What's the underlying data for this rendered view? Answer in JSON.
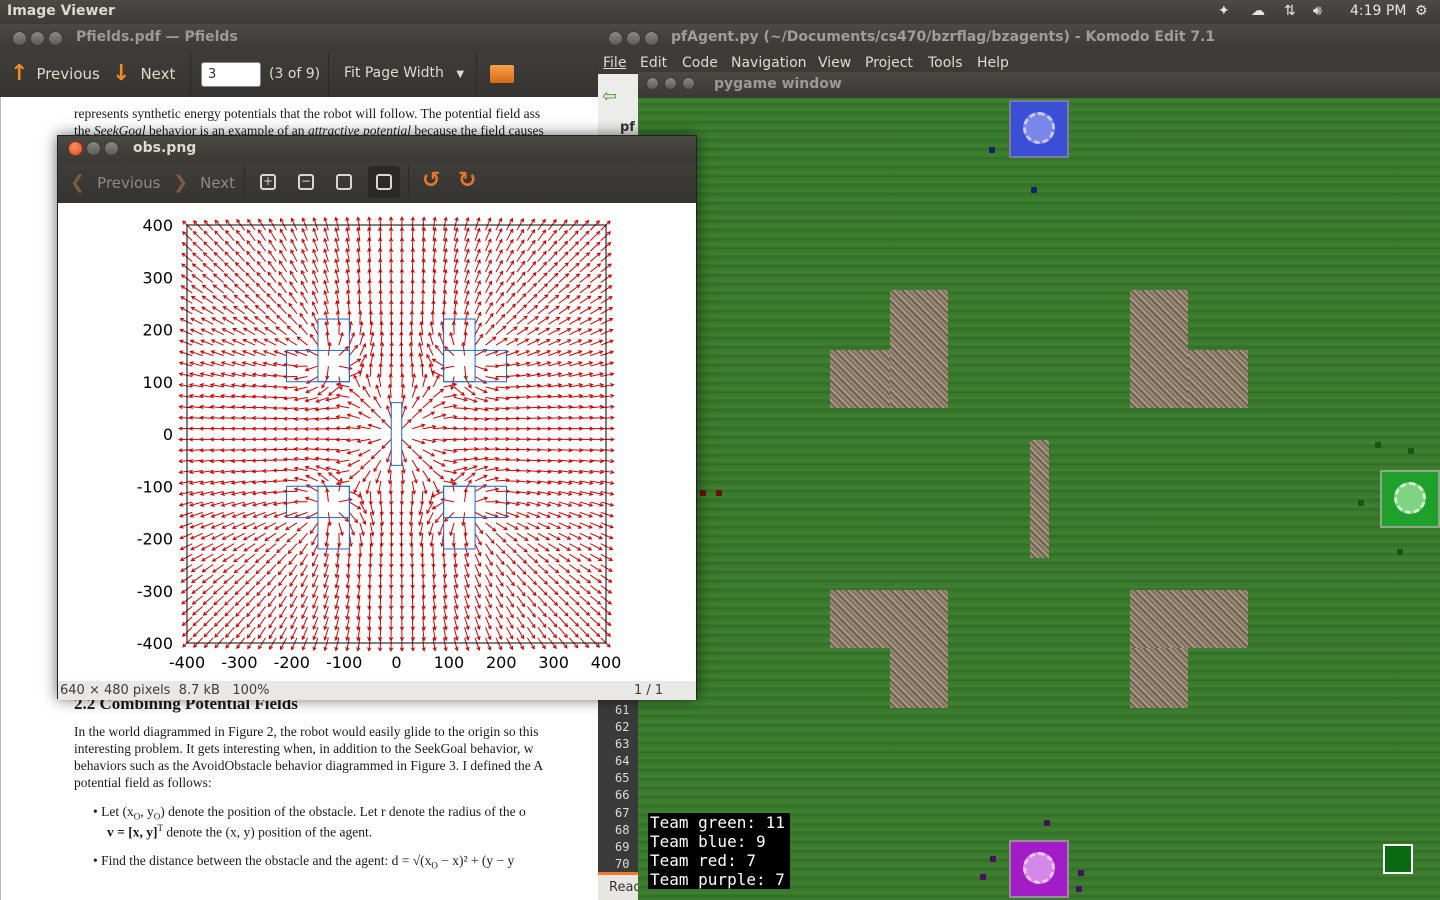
{
  "top_panel": {
    "app_name": "Image Viewer",
    "time": "4:19 PM",
    "indicators": [
      "dropbox-icon",
      "cloud-icon",
      "network-icon",
      "volume-icon",
      "gear-icon"
    ]
  },
  "evince": {
    "title": "Pfields.pdf — Pfields",
    "toolbar": {
      "previous": "Previous",
      "next": "Next",
      "page_value": "3",
      "page_count": "(3 of 9)",
      "zoom": "Fit Page Width"
    },
    "page_text": {
      "line1": "represents synthetic energy potentials that the robot will follow.  The potential field ass",
      "line2_a": "the ",
      "line2_em": "SeekGoal",
      "line2_b": " behavior is an example of an ",
      "line2_em2": "attractive potential",
      "line2_c": " because the field causes",
      "section": "2.2    Combining Potential Fields",
      "p1": "In the world diagrammed in Figure 2, the robot would easily glide to the origin so this",
      "p2": "interesting problem.  It gets interesting when, in addition to the SeekGoal behavior, w",
      "p3": "behaviors such as the AvoidObstacle behavior diagrammed in Figure 3. I defined the A",
      "p4": "potential field as follows:",
      "b1a": "Let (x",
      "b1b": "O",
      "b1c": ", y",
      "b1d": "O",
      "b1e": ") denote the position of the obstacle.  Let r denote the radius of the o",
      "b1f": "v = [x, y]",
      "b1g": "T",
      "b1h": " denote the (x, y) position of the agent.",
      "b2": "Find the distance between the obstacle and the agent: d = ",
      "b2math": "√(x",
      "b2math2": "O",
      "b2math3": " − x)² + (y − y"
    }
  },
  "eog": {
    "title": "obs.png",
    "toolbar": {
      "previous": "Previous",
      "next": "Next"
    },
    "status": {
      "info": "640 × 480 pixels  8.7 kB   100%",
      "page": "1 / 1"
    }
  },
  "chart_data": {
    "type": "quiver",
    "title": "",
    "xlabel": "",
    "ylabel": "",
    "xlim": [
      -400,
      400
    ],
    "ylim": [
      -400,
      400
    ],
    "xticks": [
      "-400",
      "-300",
      "-200",
      "-100",
      "0",
      "100",
      "200",
      "300",
      "400"
    ],
    "yticks": [
      "400",
      "300",
      "200",
      "100",
      "0",
      "-100",
      "-200",
      "-300",
      "-400"
    ],
    "grid_step": 20,
    "obstacles": [
      {
        "name": "top-left",
        "rects": [
          [
            -150,
            100,
            -90,
            220
          ],
          [
            -210,
            100,
            -90,
            160
          ]
        ]
      },
      {
        "name": "top-right",
        "rects": [
          [
            90,
            100,
            150,
            220
          ],
          [
            90,
            100,
            210,
            160
          ]
        ]
      },
      {
        "name": "bottom-left",
        "rects": [
          [
            -150,
            -220,
            -90,
            -100
          ],
          [
            -210,
            -160,
            -90,
            -100
          ]
        ]
      },
      {
        "name": "bottom-right",
        "rects": [
          [
            90,
            -220,
            150,
            -100
          ],
          [
            90,
            -160,
            210,
            -100
          ]
        ]
      },
      {
        "name": "center",
        "rects": [
          [
            -10,
            -60,
            10,
            60
          ]
        ]
      }
    ],
    "arrow_color": "#d00000",
    "obstacle_color": "#1f66c6"
  },
  "komodo": {
    "title": "pfAgent.py (~/Documents/cs470/bzrflag/bzagents) - Komodo Edit 7.1",
    "menu": [
      "File",
      "Edit",
      "Code",
      "Navigation",
      "View",
      "Project",
      "Tools",
      "Help"
    ],
    "line_numbers": [
      "61",
      "62",
      "63",
      "64",
      "65",
      "66",
      "67",
      "68",
      "69",
      "70"
    ],
    "status_fragment": "Read",
    "tab_fragment": "pf"
  },
  "pygame": {
    "title": "pygame window",
    "scores": [
      "Team green: 11",
      "Team blue: 9",
      "Team red: 7",
      "Team purple: 7"
    ],
    "colors": {
      "green": "#1fa02a",
      "blue": "#3b4fd6",
      "purple": "#a21cc8",
      "red": "#b41c1c"
    }
  }
}
